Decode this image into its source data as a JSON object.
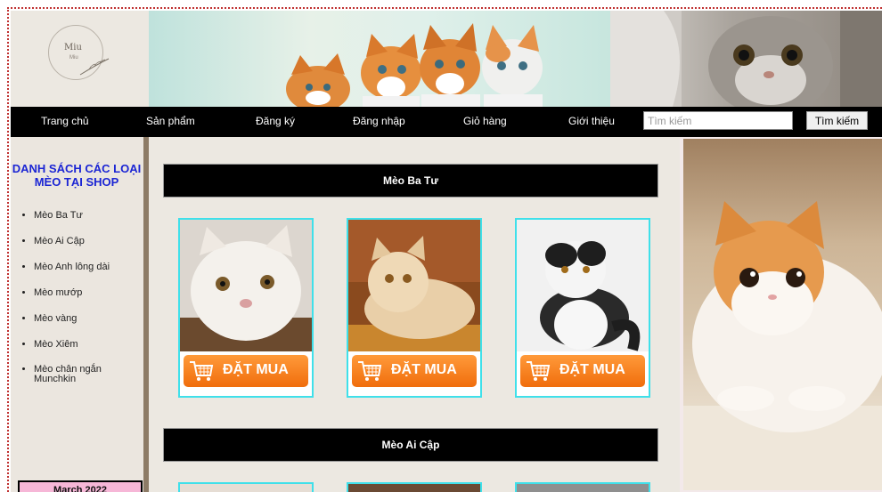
{
  "logo": {
    "brand": "Miu",
    "sub": "Miu"
  },
  "nav": {
    "items": [
      "Trang chủ",
      "Sản phẩm",
      "Đăng ký",
      "Đăng nhập",
      "Giỏ hàng",
      "Giới thiệu"
    ],
    "search_placeholder": "Tìm kiếm",
    "search_button": "Tìm kiếm"
  },
  "sidebar": {
    "title": "DANH SÁCH CÁC LOẠI MÈO TẠI SHOP",
    "items": [
      "Mèo Ba Tư",
      "Mèo Ai Cập",
      "Mèo Anh lông dài",
      "Mèo mướp",
      "Mèo vàng",
      "Mèo Xiêm",
      "Mèo chân ngắn Munchkin"
    ],
    "calendar": "March 2022"
  },
  "sections": [
    {
      "title": "Mèo Ba Tư",
      "buy_label": "ĐẶT MUA"
    },
    {
      "title": "Mèo Ai Cập"
    }
  ],
  "colors": {
    "accent_blue": "#1b25d4",
    "buy_orange": "#f07d1a",
    "card_border": "#3fe0ea",
    "calendar_pink": "#f6b7d7"
  }
}
